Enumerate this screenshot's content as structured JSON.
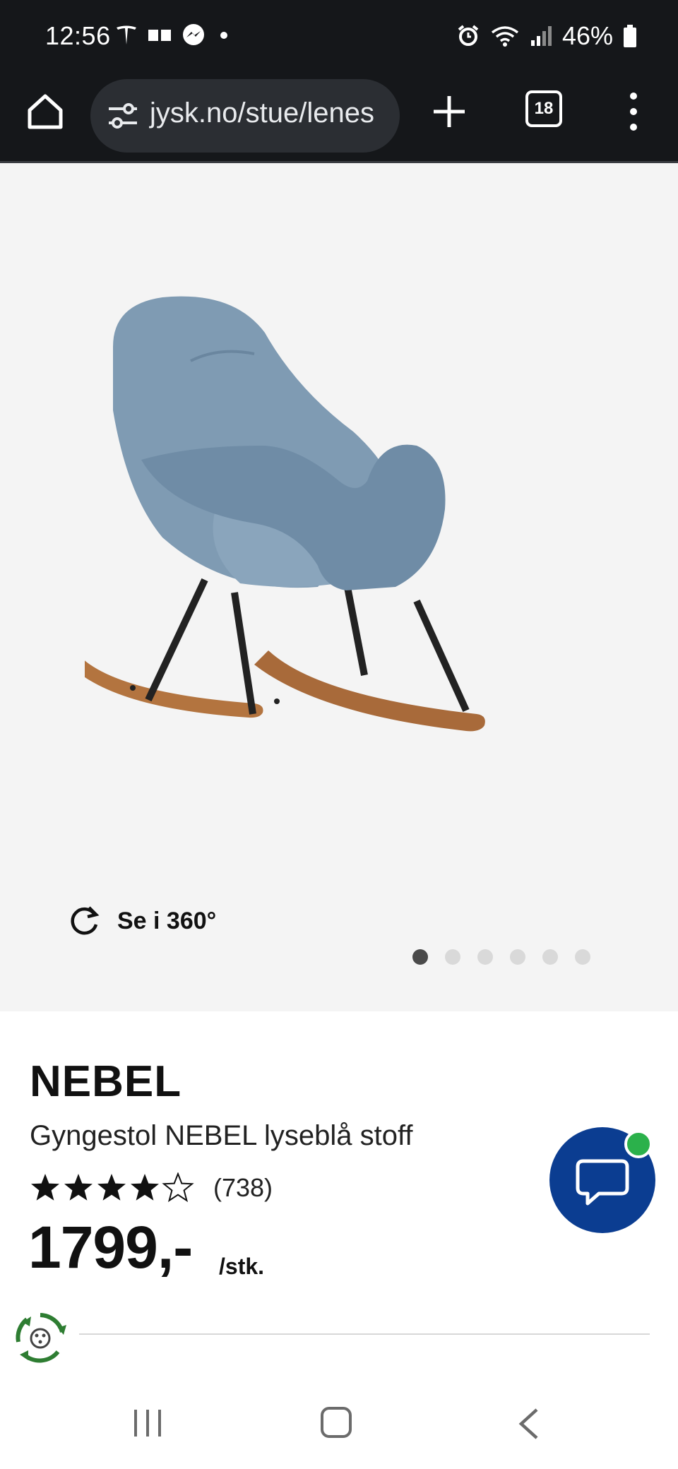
{
  "status_bar": {
    "time": "12:56",
    "battery": "46%",
    "left_icons": [
      "tesla-icon",
      "voicemail-icon",
      "messenger-icon",
      "dot-icon"
    ],
    "right_icons": [
      "alarm-icon",
      "wifi-icon",
      "signal-icon",
      "battery-icon"
    ]
  },
  "browser": {
    "url": "jysk.no/stue/lenes",
    "tab_count": "18",
    "icons": [
      "home-icon",
      "site-settings-icon",
      "plus-icon",
      "tabs-icon",
      "more-vert-icon"
    ]
  },
  "gallery": {
    "view_360_label": "Se i 360°",
    "image_count": 6,
    "active_index": 0,
    "chair_colors": {
      "fabric": "#7f9bb3",
      "legs": "#222222",
      "runners": "#a86a3a",
      "background": "#f4f4f4"
    }
  },
  "product": {
    "brand": "NEBEL",
    "name": "Gyngestol NEBEL lyseblå stoff",
    "rating": 4.5,
    "rating_max": 5,
    "review_count": "(738)",
    "price": "1799,-",
    "unit": "/stk."
  },
  "chat": {
    "icon": "chat-icon",
    "online_color": "#2bb14b",
    "button_color": "#0b3d91"
  },
  "eco": {
    "icon": "circular-economy-icon",
    "color": "#2e7d32"
  },
  "system_nav": {
    "icons": [
      "recents-icon",
      "home-nav-icon",
      "back-icon"
    ]
  }
}
